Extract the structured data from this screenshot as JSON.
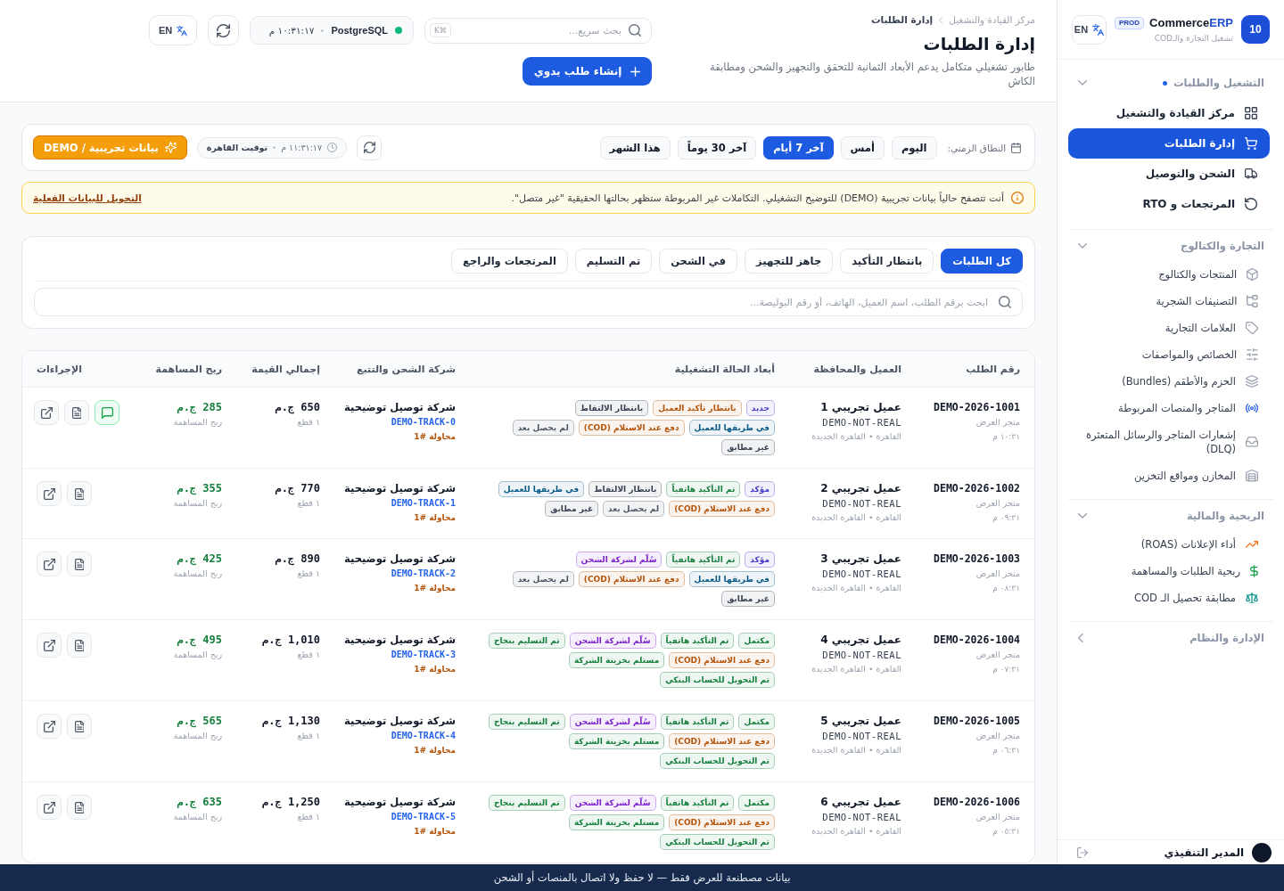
{
  "sidebar": {
    "logo": "10",
    "brand": {
      "name": "Commerce",
      "accent": "ERP"
    },
    "environment": "PROD",
    "tagline": "تشغيل التجارة والـCOD",
    "language_button": "EN",
    "sections": [
      {
        "title": "التشغيل والطلبات",
        "kind": "primary",
        "active": true,
        "expanded": true,
        "items": [
          {
            "label": "مركز القيادة والتشغيل",
            "selected": false
          },
          {
            "label": "إدارة الطلبات",
            "selected": true
          },
          {
            "label": "الشحن والتوصيل",
            "selected": false
          },
          {
            "label": "المرتجعات و RTO",
            "selected": false
          }
        ]
      },
      {
        "title": "التجارة والكتالوج",
        "kind": "secondary",
        "active": false,
        "expanded": true,
        "items": [
          {
            "label": "المنتجات والكتالوج",
            "selected": false
          },
          {
            "label": "التصنيفات الشجرية",
            "selected": false
          },
          {
            "label": "العلامات التجارية",
            "selected": false
          },
          {
            "label": "الخصائص والمواصفات",
            "selected": false
          },
          {
            "label": "الحزم والأطقم (Bundles)",
            "selected": false
          },
          {
            "label": "المتاجر والمنصات المربوطة",
            "selected": false
          },
          {
            "label": "إشعارات المتاجر والرسائل المتعثرة (DLQ)",
            "selected": false
          },
          {
            "label": "المخازن ومواقع التخزين",
            "selected": false
          }
        ]
      },
      {
        "title": "الربحية والمالية",
        "kind": "secondary",
        "active": false,
        "expanded": true,
        "items": [
          {
            "label": "أداء الإعلانات (ROAS)",
            "selected": false
          },
          {
            "label": "ربحية الطلبات والمساهمة",
            "selected": false
          },
          {
            "label": "مطابقة تحصيل الـ COD",
            "selected": false
          }
        ]
      },
      {
        "title": "الإدارة والنظام",
        "active": false,
        "expanded": false
      }
    ],
    "user": {
      "name": "المدير التنفيذي"
    }
  },
  "header": {
    "breadcrumb": [
      "مركز القيادة والتشغيل",
      "إدارة الطلبات"
    ],
    "title": "إدارة الطلبات",
    "subtitle": "طابور تشغيلي متكامل يدعم الأبعاد الثمانية للتحقق والتجهيز والشحن ومطابقة الكاش",
    "search": {
      "placeholder": "بحث سريع...",
      "shortcut": "⌘K"
    },
    "status": {
      "online": true,
      "database": "PostgreSQL",
      "time": "١٠:٣١:١٧ م"
    },
    "language_button": "EN",
    "create_button": "إنشاء طلب يدوي"
  },
  "filters": {
    "label": "النطاق الزمني:",
    "ranges": [
      {
        "label": "اليوم",
        "selected": false
      },
      {
        "label": "أمس",
        "selected": false
      },
      {
        "label": "آخر 7 أيام",
        "selected": true
      },
      {
        "label": "آخر 30 يوماً",
        "selected": false
      },
      {
        "label": "هذا الشهر",
        "selected": false
      }
    ],
    "clock": "١١:٣١:١٧ م",
    "timezone": "توقيت القاهرة",
    "demo_button": "بيانات تجريبية / DEMO"
  },
  "alert": {
    "message": "أنت تتصفح حالياً بيانات تجريبية (DEMO) للتوضيح التشغيلي. التكاملات غير المربوطة ستظهر بحالتها الحقيقية \"غير متصل\".",
    "link": "التحويل للبيانات الفعلية"
  },
  "tabs": [
    {
      "label": "كل الطلبات",
      "selected": true
    },
    {
      "label": "بانتظار التأكيد",
      "selected": false
    },
    {
      "label": "جاهز للتجهيز",
      "selected": false
    },
    {
      "label": "في الشحن",
      "selected": false
    },
    {
      "label": "تم التسليم",
      "selected": false
    },
    {
      "label": "المرتجعات والراجع",
      "selected": false
    }
  ],
  "order_search": {
    "placeholder": "ابحث برقم الطلب، اسم العميل، الهاتف، أو رقم البوليصة..."
  },
  "table": {
    "columns": [
      "رقم الطلب",
      "العميل والمحافظة",
      "أبعاد الحالة التشغيلية",
      "شركة الشحن والتتبع",
      "إجمالي القيمة",
      "ربح المساهمة",
      "الإجراءات"
    ],
    "rows": [
      {
        "order_id": "DEMO-2026-1001",
        "store": "متجر العرض",
        "time": "١٠:٣١ م",
        "customer": "عميل تجريبي 1",
        "customer_ref": "DEMO-NOT-REAL",
        "location": "القاهرة • القاهرة الجديدة",
        "tags": [
          {
            "label": "جديد",
            "color": "#4338ca"
          },
          {
            "label": "بانتظار تأكيد العميل",
            "color": "#b45309"
          },
          {
            "label": "بانتظار الالتقاط",
            "color": "#374151"
          },
          {
            "label": "في طريقها للعميل",
            "color": "#075985"
          },
          {
            "label": "دفع عند الاستلام (COD)",
            "color": "#b45309"
          },
          {
            "label": "لم يحصل بعد",
            "color": "#4b5563"
          },
          {
            "label": "غير مطابق",
            "color": "#374151"
          }
        ],
        "carrier": "شركة توصيل توضيحية",
        "tracking": "DEMO-TRACK-0",
        "attempt": "محاولة #1",
        "total": "650 ج.م",
        "pieces": "١ قطع",
        "profit": "285 ج.م",
        "profit_label": "ربح المساهمة",
        "chat": true
      },
      {
        "order_id": "DEMO-2026-1002",
        "store": "متجر العرض",
        "time": "٠٩:٣١ م",
        "customer": "عميل تجريبي 2",
        "customer_ref": "DEMO-NOT-REAL",
        "location": "القاهرة • القاهرة الجديدة",
        "tags": [
          {
            "label": "مؤكد",
            "color": "#4338ca"
          },
          {
            "label": "تم التأكيد هاتفياً",
            "color": "#15803d"
          },
          {
            "label": "بانتظار الالتقاط",
            "color": "#374151"
          },
          {
            "label": "في طريقها للعميل",
            "color": "#075985"
          },
          {
            "label": "دفع عند الاستلام (COD)",
            "color": "#b45309"
          },
          {
            "label": "لم يحصل بعد",
            "color": "#4b5563"
          },
          {
            "label": "غير مطابق",
            "color": "#374151"
          }
        ],
        "carrier": "شركة توصيل توضيحية",
        "tracking": "DEMO-TRACK-1",
        "attempt": "محاولة #1",
        "total": "770 ج.م",
        "pieces": "١ قطع",
        "profit": "355 ج.م",
        "profit_label": "ربح المساهمة",
        "chat": false
      },
      {
        "order_id": "DEMO-2026-1003",
        "store": "متجر العرض",
        "time": "٠٨:٣١ م",
        "customer": "عميل تجريبي 3",
        "customer_ref": "DEMO-NOT-REAL",
        "location": "القاهرة • القاهرة الجديدة",
        "tags": [
          {
            "label": "مؤكد",
            "color": "#4338ca"
          },
          {
            "label": "تم التأكيد هاتفياً",
            "color": "#15803d"
          },
          {
            "label": "سُلّم لشركة الشحن",
            "color": "#7e22ce"
          },
          {
            "label": "في طريقها للعميل",
            "color": "#075985"
          },
          {
            "label": "دفع عند الاستلام (COD)",
            "color": "#b45309"
          },
          {
            "label": "لم يحصل بعد",
            "color": "#4b5563"
          },
          {
            "label": "غير مطابق",
            "color": "#374151"
          }
        ],
        "carrier": "شركة توصيل توضيحية",
        "tracking": "DEMO-TRACK-2",
        "attempt": "محاولة #1",
        "total": "890 ج.م",
        "pieces": "١ قطع",
        "profit": "425 ج.م",
        "profit_label": "ربح المساهمة",
        "chat": false
      },
      {
        "order_id": "DEMO-2026-1004",
        "store": "متجر العرض",
        "time": "٠٧:٣١ م",
        "customer": "عميل تجريبي 4",
        "customer_ref": "DEMO-NOT-REAL",
        "location": "القاهرة • القاهرة الجديدة",
        "tags": [
          {
            "label": "مكتمل",
            "color": "#15803d"
          },
          {
            "label": "تم التأكيد هاتفياً",
            "color": "#15803d"
          },
          {
            "label": "سُلّم لشركة الشحن",
            "color": "#7e22ce"
          },
          {
            "label": "تم التسليم بنجاح",
            "color": "#15803d"
          },
          {
            "label": "دفع عند الاستلام (COD)",
            "color": "#b45309"
          },
          {
            "label": "مستلم بخزينة الشركة",
            "color": "#15803d"
          },
          {
            "label": "تم التحويل للحساب البنكي",
            "color": "#15803d"
          }
        ],
        "carrier": "شركة توصيل توضيحية",
        "tracking": "DEMO-TRACK-3",
        "attempt": "محاولة #1",
        "total": "1,010 ج.م",
        "pieces": "١ قطع",
        "profit": "495 ج.م",
        "profit_label": "ربح المساهمة",
        "chat": false
      },
      {
        "order_id": "DEMO-2026-1005",
        "store": "متجر العرض",
        "time": "٠٦:٣١ م",
        "customer": "عميل تجريبي 5",
        "customer_ref": "DEMO-NOT-REAL",
        "location": "القاهرة • القاهرة الجديدة",
        "tags": [
          {
            "label": "مكتمل",
            "color": "#15803d"
          },
          {
            "label": "تم التأكيد هاتفياً",
            "color": "#15803d"
          },
          {
            "label": "سُلّم لشركة الشحن",
            "color": "#7e22ce"
          },
          {
            "label": "تم التسليم بنجاح",
            "color": "#15803d"
          },
          {
            "label": "دفع عند الاستلام (COD)",
            "color": "#b45309"
          },
          {
            "label": "مستلم بخزينة الشركة",
            "color": "#15803d"
          },
          {
            "label": "تم التحويل للحساب البنكي",
            "color": "#15803d"
          }
        ],
        "carrier": "شركة توصيل توضيحية",
        "tracking": "DEMO-TRACK-4",
        "attempt": "محاولة #1",
        "total": "1,130 ج.م",
        "pieces": "١ قطع",
        "profit": "565 ج.م",
        "profit_label": "ربح المساهمة",
        "chat": false
      },
      {
        "order_id": "DEMO-2026-1006",
        "store": "متجر العرض",
        "time": "٠٥:٣١ م",
        "customer": "عميل تجريبي 6",
        "customer_ref": "DEMO-NOT-REAL",
        "location": "القاهرة • القاهرة الجديدة",
        "tags": [
          {
            "label": "مكتمل",
            "color": "#15803d"
          },
          {
            "label": "تم التأكيد هاتفياً",
            "color": "#15803d"
          },
          {
            "label": "سُلّم لشركة الشحن",
            "color": "#7e22ce"
          },
          {
            "label": "تم التسليم بنجاح",
            "color": "#15803d"
          },
          {
            "label": "دفع عند الاستلام (COD)",
            "color": "#b45309"
          },
          {
            "label": "مستلم بخزينة الشركة",
            "color": "#15803d"
          },
          {
            "label": "تم التحويل للحساب البنكي",
            "color": "#15803d"
          }
        ],
        "carrier": "شركة توصيل توضيحية",
        "tracking": "DEMO-TRACK-5",
        "attempt": "محاولة #1",
        "total": "1,250 ج.م",
        "pieces": "١ قطع",
        "profit": "635 ج.م",
        "profit_label": "ربح المساهمة",
        "chat": false
      }
    ]
  },
  "banner": "بيانات مصطنعة للعرض فقط — لا حفظ ولا اتصال بالمنصات أو الشحن"
}
